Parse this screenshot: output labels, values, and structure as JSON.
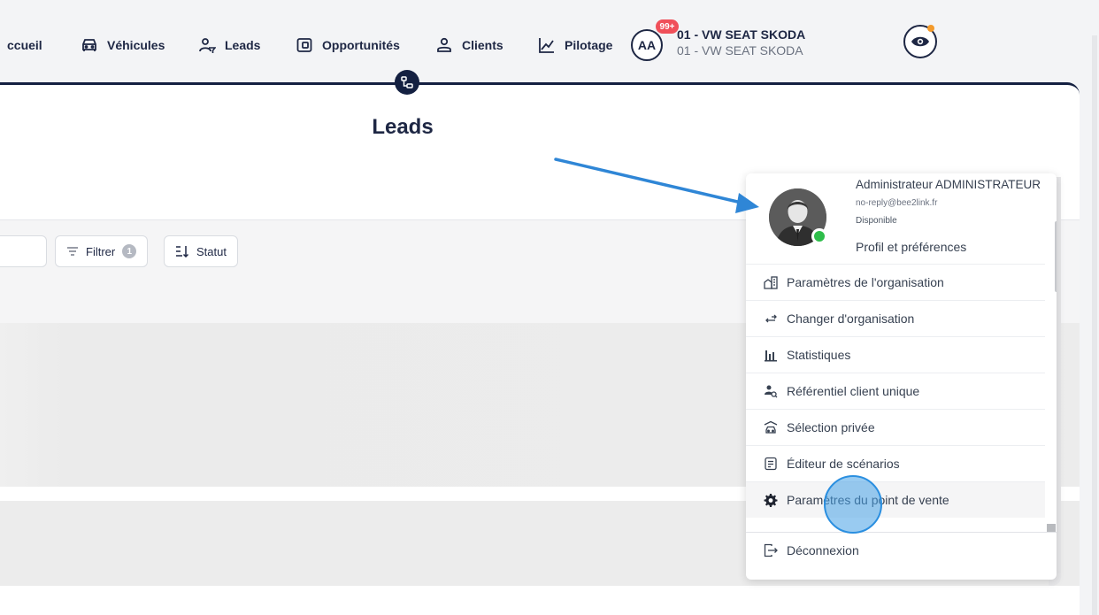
{
  "nav": {
    "items": [
      {
        "label": "ccueil",
        "icon": "home-icon"
      },
      {
        "label": "Véhicules",
        "icon": "car-icon"
      },
      {
        "label": "Leads",
        "icon": "user-filter-icon"
      },
      {
        "label": "Opportunités",
        "icon": "wallet-icon"
      },
      {
        "label": "Clients",
        "icon": "user-icon"
      },
      {
        "label": "Pilotage",
        "icon": "chart-icon"
      }
    ],
    "avatar_initials": "AA",
    "notification_count": "99+",
    "org_name": "01 - VW SEAT SKODA",
    "org_subtitle": "01 - VW SEAT SKODA",
    "eye_dot_color": "#f39a2b"
  },
  "page": {
    "title": "Leads"
  },
  "toolbar": {
    "filter_label": "Filtrer",
    "filter_count": "1",
    "status_label": "Statut"
  },
  "user_menu": {
    "name": "Administrateur ADMINISTRATEUR",
    "email": "no-reply@bee2link.fr",
    "status": "Disponible",
    "preferences_label": "Profil et préférences",
    "items": [
      {
        "label": "Paramètres de l'organisation",
        "icon": "organization-settings-icon"
      },
      {
        "label": "Changer d'organisation",
        "icon": "switch-arrows-icon"
      },
      {
        "label": "Statistiques",
        "icon": "bar-chart-icon"
      },
      {
        "label": "Référentiel client unique",
        "icon": "user-search-icon"
      },
      {
        "label": "Sélection privée",
        "icon": "private-car-icon"
      },
      {
        "label": "Éditeur de scénarios",
        "icon": "document-icon"
      },
      {
        "label": "Paramètres du point de vente",
        "icon": "gear-icon"
      }
    ],
    "logout_label": "Déconnexion"
  },
  "colors": {
    "navy": "#142041",
    "online": "#2ebd4a",
    "badge": "#f0505a",
    "click": "#2b8fe0"
  }
}
